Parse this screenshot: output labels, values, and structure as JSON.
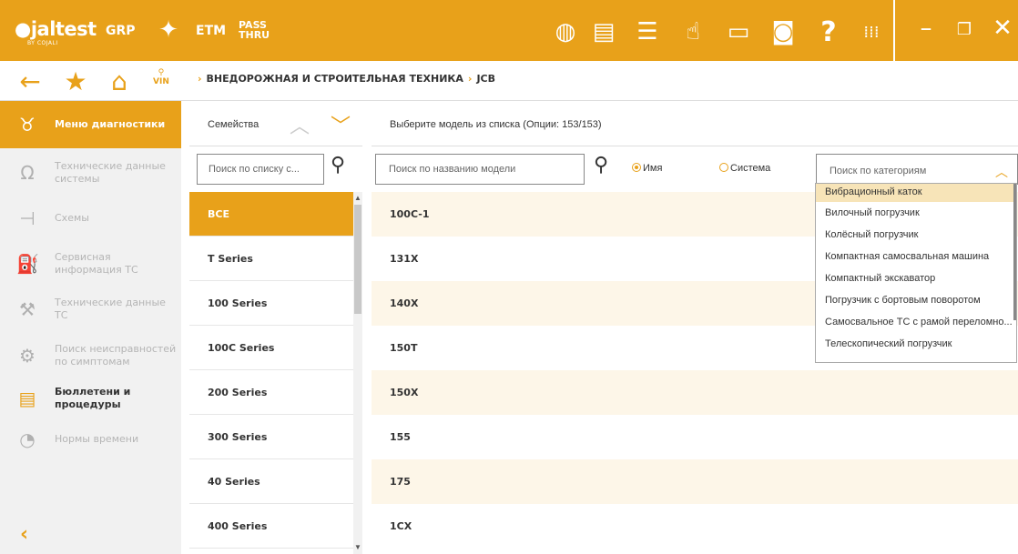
{
  "topbar": {
    "logo": "jaltest",
    "logo_sub": "BY COJALI",
    "grp": "GRP",
    "etm": "ETM",
    "pass": "PASS",
    "thru": "THRU",
    "icons": [
      "globe-icon",
      "document-icon",
      "list-icon",
      "hand-icon",
      "printer-icon",
      "camera-icon",
      "help-icon",
      "apps-grid-icon"
    ],
    "help_glyph": "?",
    "accent": "#e8a11a"
  },
  "nav": {
    "vin_label": "VIN",
    "breadcrumb": [
      "ВНЕДОРОЖНАЯ И СТРОИТЕЛЬНАЯ ТЕХНИКА",
      "JCB"
    ]
  },
  "sidebar": {
    "items": [
      {
        "label": "Меню диагностики",
        "icon": "stethoscope-icon"
      },
      {
        "label": "Технические данные системы",
        "icon": "omega-icon"
      },
      {
        "label": "Схемы",
        "icon": "schematic-icon"
      },
      {
        "label": "Сервисная информация ТС",
        "icon": "oil-can-icon"
      },
      {
        "label": "Технические данные ТС",
        "icon": "wrench-icon"
      },
      {
        "label": "Поиск неисправностей по симптомам",
        "icon": "troubleshoot-icon"
      },
      {
        "label": "Бюллетени и процедуры",
        "icon": "bulletin-icon"
      },
      {
        "label": "Нормы времени",
        "icon": "clock-gear-icon"
      }
    ]
  },
  "families": {
    "title": "Семейства",
    "search_placeholder": "Поиск по списку с...",
    "items": [
      "ВСЕ",
      "T Series",
      "100 Series",
      "100C Series",
      "200 Series",
      "300 Series",
      "40 Series",
      "400 Series"
    ]
  },
  "models": {
    "title": "Выберите модель из списка (Опции: 153/153)",
    "search_placeholder": "Поиск по названию модели",
    "radio_name": "Имя",
    "radio_system": "Система",
    "category_placeholder": "Поиск по категориям",
    "items": [
      "100C-1",
      "131X",
      "140X",
      "150T",
      "150X",
      "155",
      "175",
      "1CX"
    ]
  },
  "category_dropdown": {
    "options": [
      "Вибрационный каток",
      "Вилочный погрузчик",
      "Колёсный погрузчик",
      "Компактная самосвальная машина",
      "Компактный экскаватор",
      "Погрузчик с бортовым поворотом",
      "Самосвальное ТС с рамой переломно...",
      "Телескопический погрузчик"
    ]
  }
}
